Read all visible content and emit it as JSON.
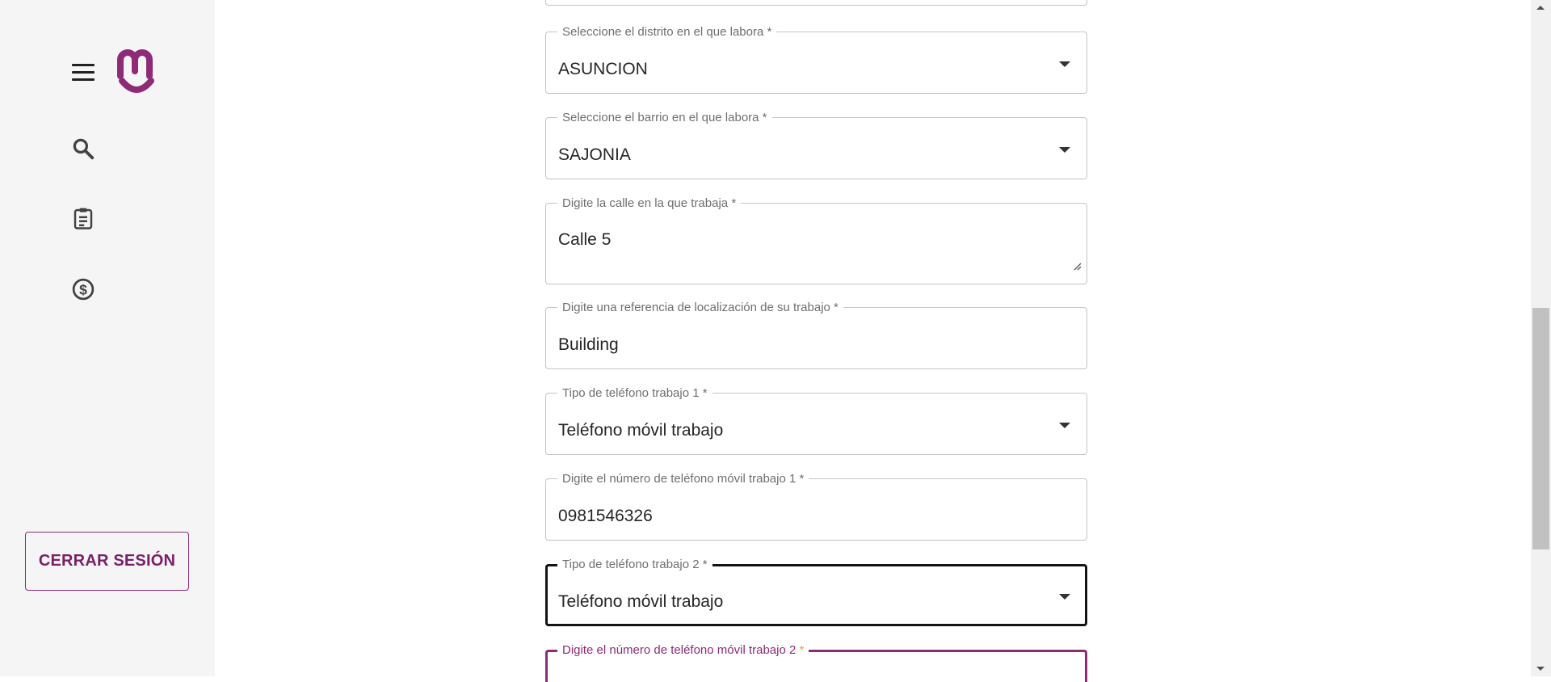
{
  "sidebar": {
    "menu_icon": "hamburger-menu-icon",
    "logo": "m-smile-logo",
    "nav_icons": [
      "search-icon",
      "clipboard-icon",
      "dollar-coin-icon"
    ],
    "logout_label": "CERRAR SESIÓN"
  },
  "form": {
    "fields": [
      {
        "label": "Seleccione el distrito en el que labora",
        "required": "*",
        "value": "ASUNCION",
        "type": "select"
      },
      {
        "label": "Seleccione el barrio en el que labora",
        "required": "*",
        "value": "SAJONIA",
        "type": "select"
      },
      {
        "label": "Digite la calle en la que trabaja",
        "required": "*",
        "value": "Calle 5",
        "type": "textarea"
      },
      {
        "label": "Digite una referencia de localización de su trabajo",
        "required": "*",
        "value": "Building",
        "type": "text"
      },
      {
        "label": "Tipo de teléfono trabajo 1",
        "required": "*",
        "value": "Teléfono móvil trabajo",
        "type": "select"
      },
      {
        "label": "Digite el número de teléfono móvil trabajo 1",
        "required": "*",
        "value": "0981546326",
        "type": "text"
      },
      {
        "label": "Tipo de teléfono trabajo 2",
        "required": "*",
        "value": "Teléfono móvil trabajo",
        "type": "select",
        "state": "focused"
      },
      {
        "label": "Digite el número de teléfono móvil trabajo 2",
        "required": "*",
        "value": "",
        "type": "text",
        "state": "error"
      }
    ]
  },
  "colors": {
    "brand": "#8e2a76",
    "sidebar_bg": "#f5f5f5",
    "field_border": "#c4c4c4",
    "focused_border": "#141414",
    "required_error": "#e2a23a"
  }
}
